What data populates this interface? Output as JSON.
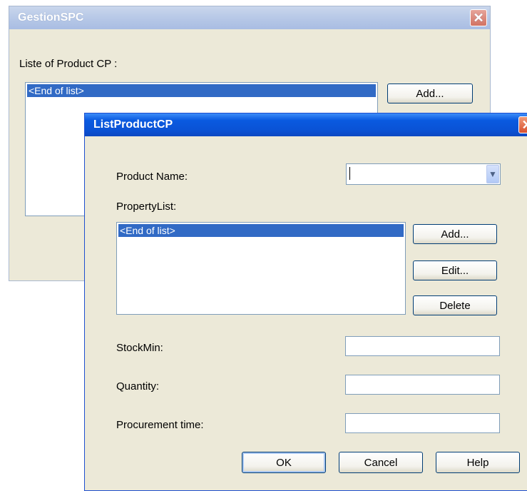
{
  "main_window": {
    "title": "GestionSPC",
    "list_label": "Liste of Product CP  :",
    "list_items": [
      "<End of list>"
    ],
    "add_label": "Add..."
  },
  "dialog": {
    "title": "ListProductCP",
    "product_name_label": "Product Name:",
    "product_name_value": "",
    "property_list_label": "PropertyList:",
    "property_items": [
      "<End of list>"
    ],
    "add_label": "Add...",
    "edit_label": "Edit...",
    "delete_label": "Delete",
    "stockmin_label": "StockMin:",
    "quantity_label": "Quantity:",
    "procurement_label": "Procurement time:",
    "ok_label": "OK",
    "cancel_label": "Cancel",
    "help_label": "Help"
  },
  "icons": {
    "close": "close-icon",
    "dropdown": "chevron-down-icon"
  }
}
